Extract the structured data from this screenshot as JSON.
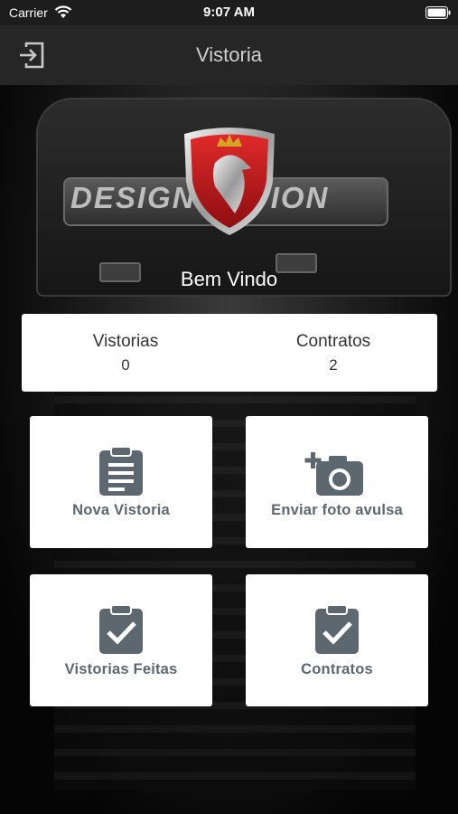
{
  "status_bar": {
    "carrier": "Carrier",
    "time": "9:07 AM"
  },
  "nav": {
    "title": "Vistoria",
    "left_icon": "logout-icon"
  },
  "hero": {
    "brand_text": "DESIGNEDITION",
    "welcome": "Bem Vindo"
  },
  "stats": [
    {
      "label": "Vistorias",
      "value": "0"
    },
    {
      "label": "Contratos",
      "value": "2"
    }
  ],
  "tiles": [
    {
      "label": "Nova Vistoria",
      "icon": "clipboard-list-icon"
    },
    {
      "label": "Enviar foto avulsa",
      "icon": "camera-plus-icon"
    },
    {
      "label": "Vistorias Feitas",
      "icon": "clipboard-check-icon"
    },
    {
      "label": "Contratos",
      "icon": "clipboard-check-icon"
    }
  ],
  "colors": {
    "icon": "#5c6770",
    "nav_bg": "#262626",
    "status_bg": "#1d1d1d",
    "shield_red": "#c8161d"
  }
}
